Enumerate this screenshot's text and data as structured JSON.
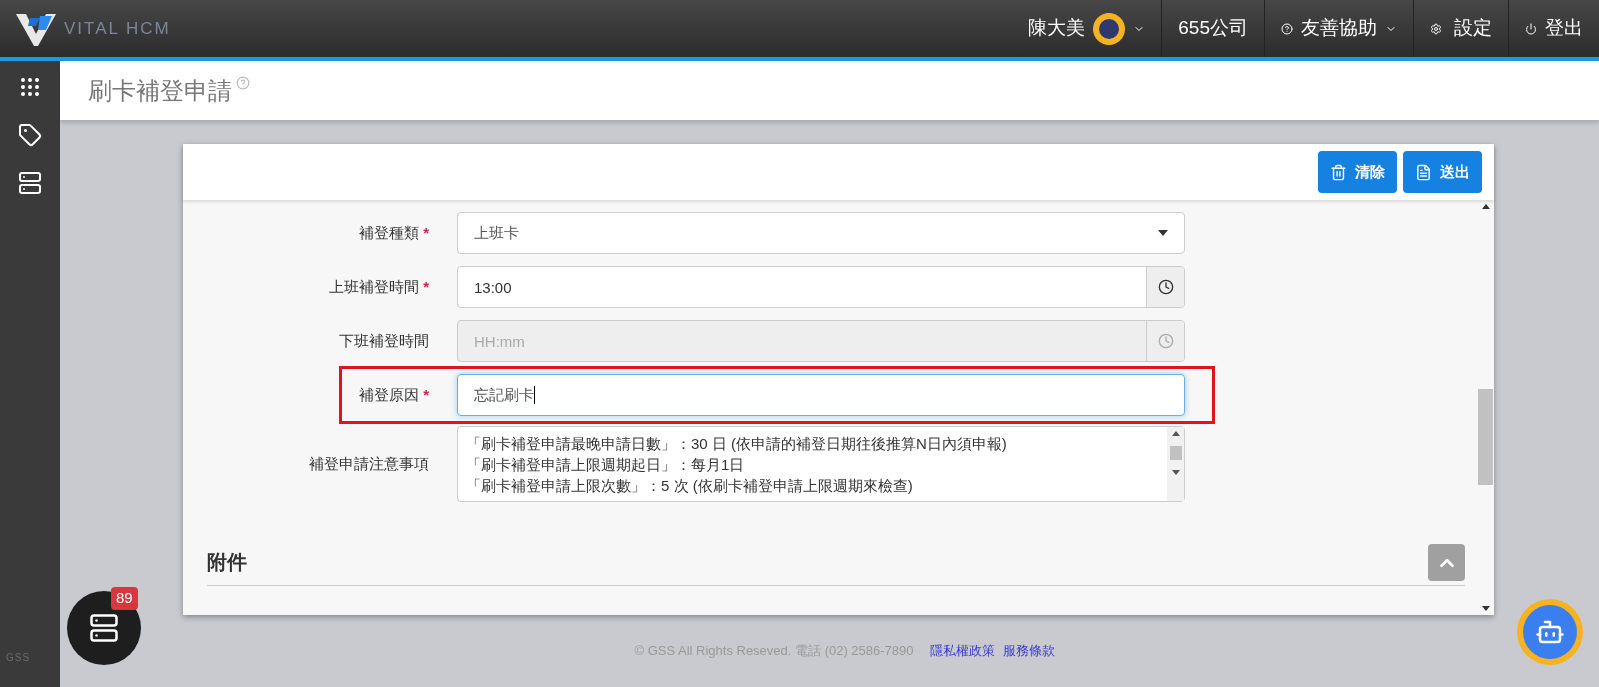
{
  "topbar": {
    "brand": "VITAL HCM",
    "user": "陳大美",
    "company": "655公司",
    "help": "友善協助",
    "settings": "設定",
    "logout": "登出"
  },
  "sidebar": {
    "items": [
      {
        "kind": "grid"
      },
      {
        "kind": "tag"
      },
      {
        "kind": "server"
      }
    ],
    "footer_logo": "GSS"
  },
  "page": {
    "title": "刷卡補登申請"
  },
  "toolbar": {
    "buttons": [
      {
        "kind": "clear",
        "label": "清除"
      },
      {
        "kind": "submit",
        "label": "送出"
      }
    ]
  },
  "form": {
    "fields": [
      {
        "kind": "select",
        "label": "補登種類",
        "required_mark": "*",
        "disabled": false,
        "highlighted": false,
        "value": "上班卡"
      },
      {
        "kind": "time",
        "label": "上班補登時間",
        "required_mark": "*",
        "disabled": false,
        "highlighted": false,
        "value": "13:00"
      },
      {
        "kind": "time",
        "label": "下班補登時間",
        "disabled": true,
        "highlighted": false,
        "placeholder": "HH:mm"
      },
      {
        "kind": "text",
        "label": "補登原因",
        "required_mark": "*",
        "disabled": false,
        "highlighted": true,
        "value": "忘記刷卡"
      },
      {
        "kind": "textarea",
        "label": "補登申請注意事項",
        "disabled": false,
        "highlighted": false,
        "lines": [
          "「刷卡補登申請最晚申請日數」：30 日 (依申請的補登日期往後推算N日內須申報)",
          "「刷卡補登申請上限週期起日」：每月1日",
          "「刷卡補登申請上限次數」：5 次 (依刷卡補登申請上限週期來檢查)"
        ]
      }
    ],
    "section": "附件"
  },
  "floating": {
    "badge": "89"
  },
  "footer": {
    "text": "© GSS All Rights Reseved. 電話 (02) 2586-7890",
    "links": [
      "隱私權政策",
      "服務條款"
    ]
  }
}
